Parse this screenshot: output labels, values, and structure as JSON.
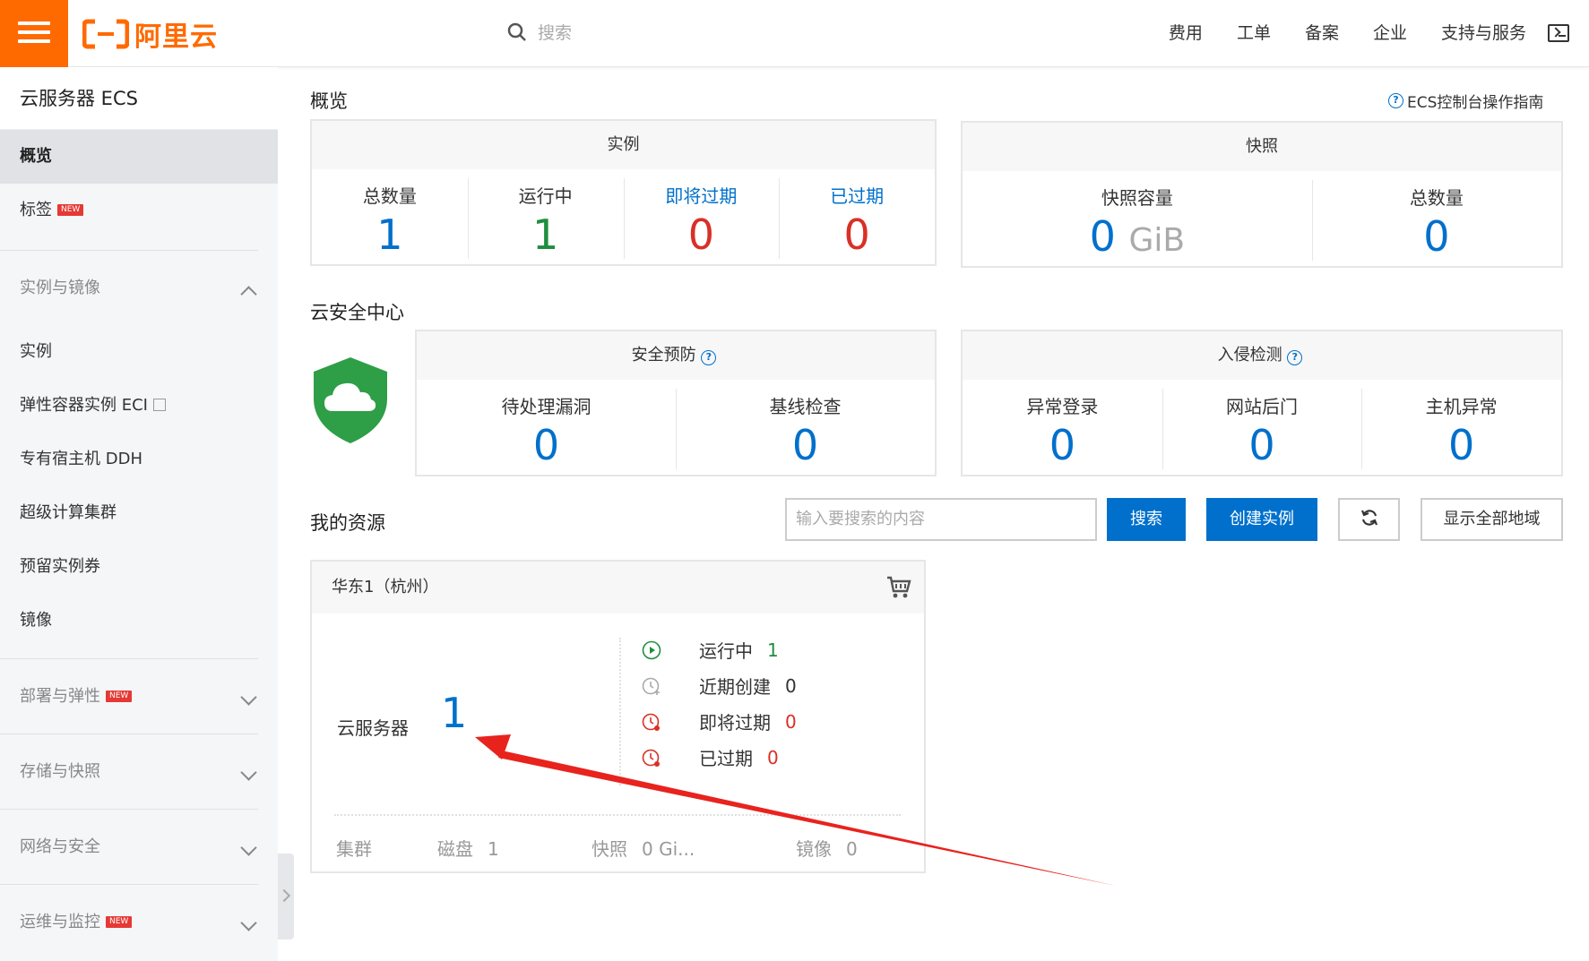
{
  "brand": {
    "logo_text": "阿里云",
    "accent": "#ff6a00"
  },
  "search": {
    "placeholder": "搜索"
  },
  "topnav": [
    "费用",
    "工单",
    "备案",
    "企业",
    "支持与服务"
  ],
  "sidebar": {
    "title": "云服务器 ECS",
    "items": [
      {
        "label": "概览"
      },
      {
        "label": "标签",
        "badge": "NEW"
      }
    ],
    "group1": {
      "label": "实例与镜像"
    },
    "group1_items": [
      "实例",
      "弹性容器实例 ECI",
      "专有宿主机 DDH",
      "超级计算集群",
      "预留实例券",
      "镜像"
    ],
    "groups": [
      {
        "label": "部署与弹性",
        "badge": "NEW"
      },
      {
        "label": "存储与快照"
      },
      {
        "label": "网络与安全"
      },
      {
        "label": "运维与监控",
        "badge": "NEW"
      }
    ]
  },
  "overview": {
    "title": "概览",
    "guide": "ECS控制台操作指南",
    "instances": {
      "title": "实例",
      "stats": [
        {
          "label": "总数量",
          "value": "1"
        },
        {
          "label": "运行中",
          "value": "1"
        },
        {
          "label": "即将过期",
          "value": "0"
        },
        {
          "label": "已过期",
          "value": "0"
        }
      ]
    },
    "snapshots": {
      "title": "快照",
      "capacity_label": "快照容量",
      "capacity_value": "0",
      "capacity_unit": "GiB",
      "count_label": "总数量",
      "count_value": "0"
    }
  },
  "security": {
    "title": "云安全中心",
    "prevention": {
      "title": "安全预防",
      "stats": [
        {
          "label": "待处理漏洞",
          "value": "0"
        },
        {
          "label": "基线检查",
          "value": "0"
        }
      ]
    },
    "intrusion": {
      "title": "入侵检测",
      "stats": [
        {
          "label": "异常登录",
          "value": "0"
        },
        {
          "label": "网站后门",
          "value": "0"
        },
        {
          "label": "主机异常",
          "value": "0"
        }
      ]
    }
  },
  "resources": {
    "title": "我的资源",
    "search_placeholder": "输入要搜索的内容",
    "search_btn": "搜索",
    "create_btn": "创建实例",
    "region_btn": "显示全部地域",
    "region": "华东1（杭州）",
    "ecs_label": "云服务器",
    "ecs_count": "1",
    "status": [
      {
        "label": "运行中",
        "value": "1"
      },
      {
        "label": "近期创建",
        "value": "0"
      },
      {
        "label": "即将过期",
        "value": "0"
      },
      {
        "label": "已过期",
        "value": "0"
      }
    ],
    "footer": [
      {
        "label": "集群",
        "value": ""
      },
      {
        "label": "磁盘",
        "value": "1"
      },
      {
        "label": "快照",
        "value": "0 Gi..."
      },
      {
        "label": "镜像",
        "value": "0"
      }
    ]
  }
}
